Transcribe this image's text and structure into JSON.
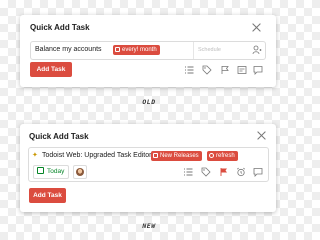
{
  "old": {
    "caption": "OLD",
    "title": "Quick Add Task",
    "task_text": "Balance my accounts",
    "chip_label": "every! month",
    "schedule_placeholder": "Schedule",
    "add_button": "Add Task"
  },
  "new": {
    "caption": "NEW",
    "title": "Quick Add Task",
    "task_text": "Todoist Web: Upgraded Task Editor",
    "project_chip": "New Releases",
    "label_chip": "refresh",
    "date_button": "Today",
    "add_button": "Add Task"
  },
  "colors": {
    "accent": "#db4c3f",
    "today": "#058527"
  },
  "icons": [
    "list-icon",
    "tag-icon",
    "flag-icon",
    "alarm-icon",
    "comment-icon",
    "assign-icon",
    "close-icon"
  ]
}
